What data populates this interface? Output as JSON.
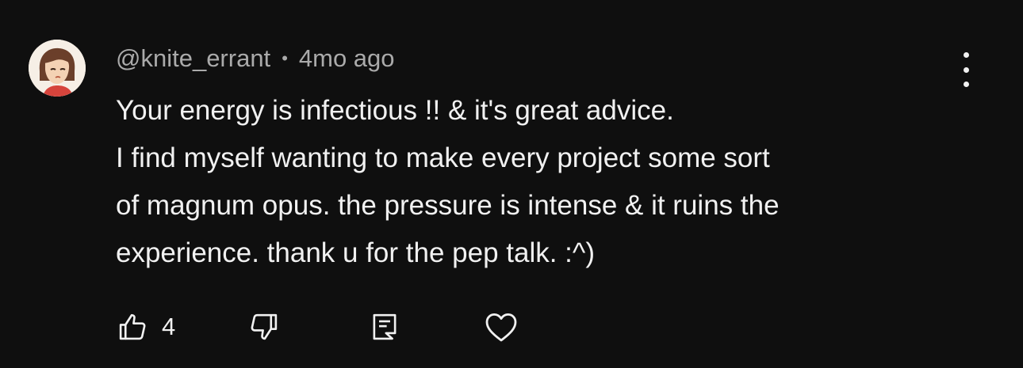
{
  "comment": {
    "author": "@knite_errant",
    "separator": "•",
    "timestamp": "4mo ago",
    "lines": [
      "Your energy is infectious !! & it's great advice.",
      "I find myself wanting to make every project some sort",
      "of magnum opus. the pressure is intense & it ruins the",
      "experience. thank u for the pep talk. :^)"
    ],
    "like_count": "4"
  },
  "icons": {
    "avatar": "avatar-illustration",
    "more": "more-vertical-icon",
    "like": "thumbs-up-icon",
    "dislike": "thumbs-down-icon",
    "reply": "reply-comment-icon",
    "heart": "heart-icon"
  },
  "colors": {
    "background": "#0f0f0f",
    "text_primary": "#f1f1f1",
    "text_secondary": "#aaaaaa"
  }
}
